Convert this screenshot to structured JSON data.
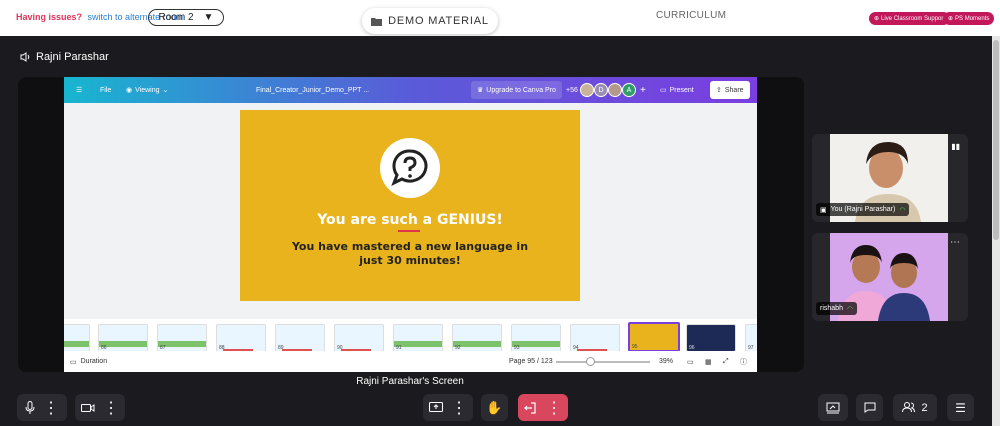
{
  "topbar": {
    "issue_text": "Having issues?",
    "alt_room_link": "switch to alternate room",
    "room_select": "Room 2",
    "tabs": [
      {
        "label": "DEMO MATERIAL"
      },
      {
        "label": "CURRICULUM"
      }
    ],
    "live_support": "Live Classroom Support",
    "ps_moments": "PS Moments"
  },
  "presenter_name": "Rajni Parashar",
  "canva": {
    "file": "File",
    "viewing": "Viewing",
    "doc_title": "Final_Creator_Junior_Demo_PPT ...",
    "upgrade": "Upgrade to Canva Pro",
    "extra_count": "+56",
    "avatars": [
      "D",
      "A"
    ],
    "present": "Present",
    "share": "Share",
    "slide_title_prefix": "You are such a ",
    "slide_title_word": "GENIUS",
    "slide_title_suffix": "!",
    "slide_body": "You have mastered a new language in just 30 minutes!",
    "thumbnails": [
      "86",
      "87",
      "88",
      "89",
      "90",
      "91",
      "92",
      "93",
      "94",
      "95",
      "96",
      "97"
    ],
    "active_thumb": "95",
    "duration": "Duration",
    "page_indicator": "Page 95 / 123",
    "zoom": "39%"
  },
  "screen_label": "Rajni Parashar's Screen",
  "participants": [
    {
      "name": "You (Rajni Parashar)"
    },
    {
      "name": "rishabh"
    }
  ],
  "controls": {
    "participants_count": "2"
  }
}
